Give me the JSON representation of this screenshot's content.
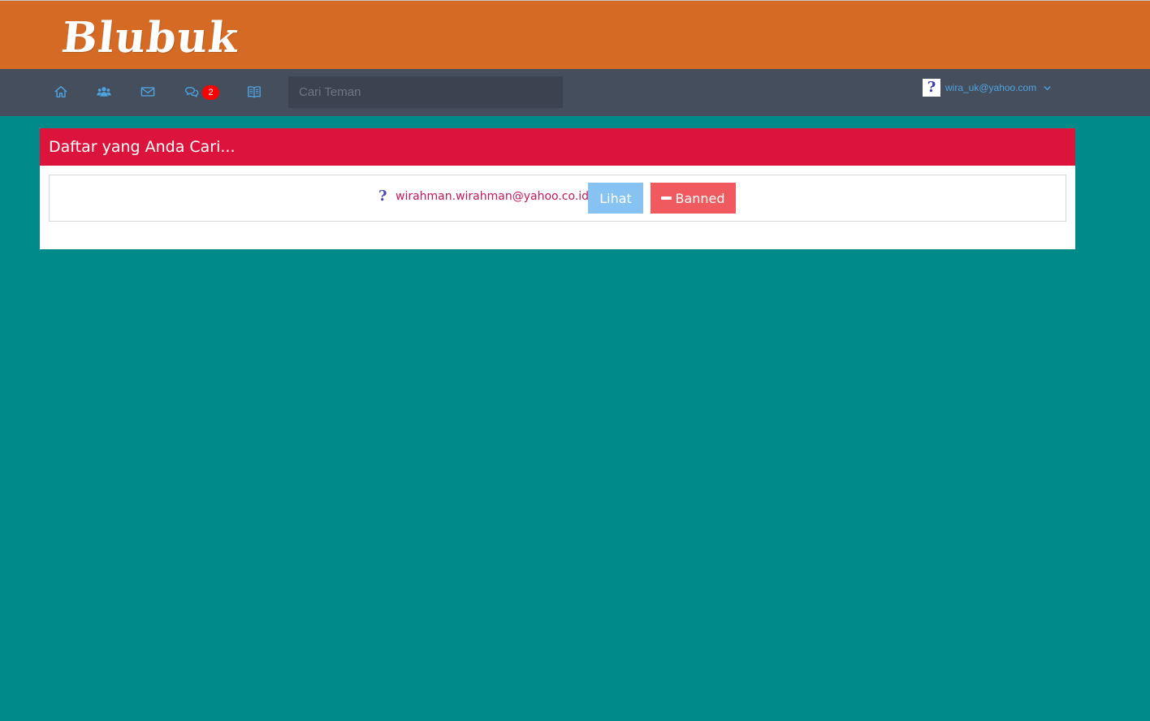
{
  "brand": {
    "logo_text": "Blubuk"
  },
  "nav": {
    "icons": [
      "home-icon",
      "users-icon",
      "envelope-icon",
      "comments-icon",
      "book-icon"
    ],
    "messages_badge": "2",
    "search_placeholder": "Cari Teman",
    "search_value": "",
    "user_email": "wira_uk@yahoo.com",
    "avatar_glyph": "?"
  },
  "panel": {
    "title": "Daftar yang Anda Cari...",
    "results": [
      {
        "avatar_glyph": "?",
        "email": "wirahman.wirahman@yahoo.co.id",
        "view_label": "Lihat",
        "ban_label": "Banned"
      }
    ]
  },
  "colors": {
    "page_bg": "#008b8a",
    "brand_bar": "#d46a23",
    "navbar": "#454e5c",
    "panel_header": "#dc143c",
    "view_button": "#87c3f2",
    "ban_button": "#f05a5e",
    "link": "#c2185b",
    "badge": "#ff0000"
  }
}
